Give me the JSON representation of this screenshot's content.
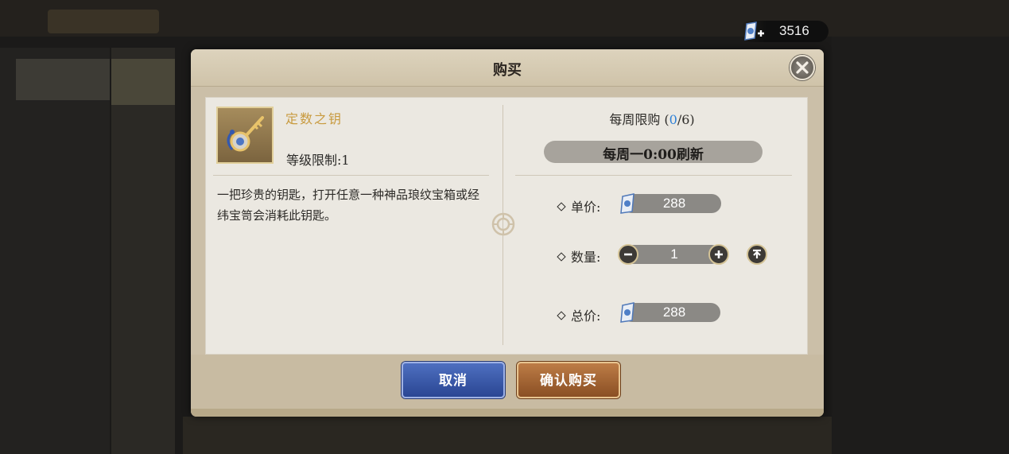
{
  "currency": {
    "icon": "ticket-plus-icon",
    "value": "3516"
  },
  "dialog": {
    "title": "购买",
    "item": {
      "icon": "key-icon",
      "name": "定数之钥",
      "level_limit": "等级限制:1",
      "description": "一把珍贵的钥匙，打开任意一种神品琅纹宝箱或经纬宝笥会消耗此钥匙。"
    },
    "weekly_limit": {
      "label": "每周限购 (",
      "used": "0",
      "sep": "/",
      "total": "6",
      "close": ")"
    },
    "refresh": "每周一0:00刷新",
    "unit_price": {
      "label": "单价:",
      "value": "288"
    },
    "quantity": {
      "label": "数量:",
      "value": "1"
    },
    "total_price": {
      "label": "总价:",
      "value": "288"
    },
    "buttons": {
      "cancel": "取消",
      "confirm": "确认购买"
    }
  },
  "colors": {
    "name": "#c89a3e",
    "limit_number": "#2e80d6",
    "cancel_button": "#3a58a8",
    "confirm_button": "#a2643a"
  }
}
